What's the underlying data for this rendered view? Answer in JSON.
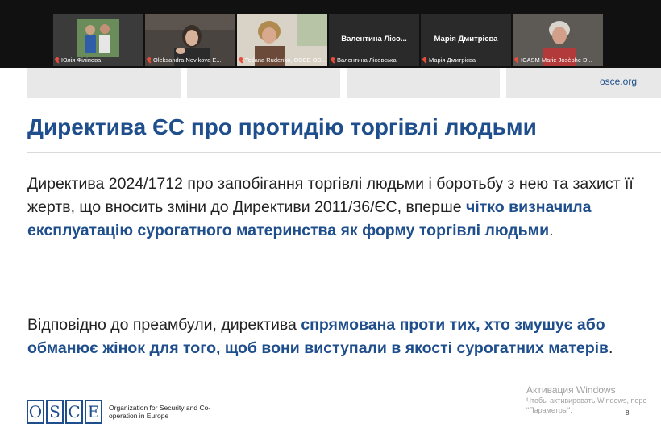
{
  "participants": [
    {
      "name": "Юлія Філіпова",
      "display": ""
    },
    {
      "name": "Oleksandra Novikova E...",
      "display": ""
    },
    {
      "name": "Tetiana Rudenko, OSCE OS...",
      "display": ""
    },
    {
      "name": "Валентина Лісовська",
      "display": "Валентина Лісо..."
    },
    {
      "name": "Марія Дмитрієва",
      "display": "Марія Дмитрієва"
    },
    {
      "name": "ICASM Marie Josèphe D...",
      "display": ""
    }
  ],
  "slide": {
    "site": "osce.org",
    "title": "Директива ЄС про протидію торгівлі людьми",
    "para1_text": "Директива 2024/1712 про запобігання торгівлі людьми і боротьбу з нею та захист її жертв, що вносить зміни до Директиви 2011/36/ЄС, вперше ",
    "para1_bold": "чітко визначила експлуатацію сурогатного материнства як форму торгівлі людьми",
    "para1_end": ".",
    "para2_text": "Відповідно до преамбули, директива ",
    "para2_bold": "спрямована проти тих, хто змушує або обманює жінок для того, щоб вони виступали в якості сурогатних матерів",
    "para2_end": ".",
    "logo_letters": [
      "O",
      "S",
      "C",
      "E"
    ],
    "org_name": "Organization for Security and Co-operation in Europe",
    "page_number": "8"
  },
  "watermark": {
    "title": "Активация Windows",
    "line1": "Чтобы активировать Windows, пере",
    "line2": "\"Параметры\"."
  }
}
